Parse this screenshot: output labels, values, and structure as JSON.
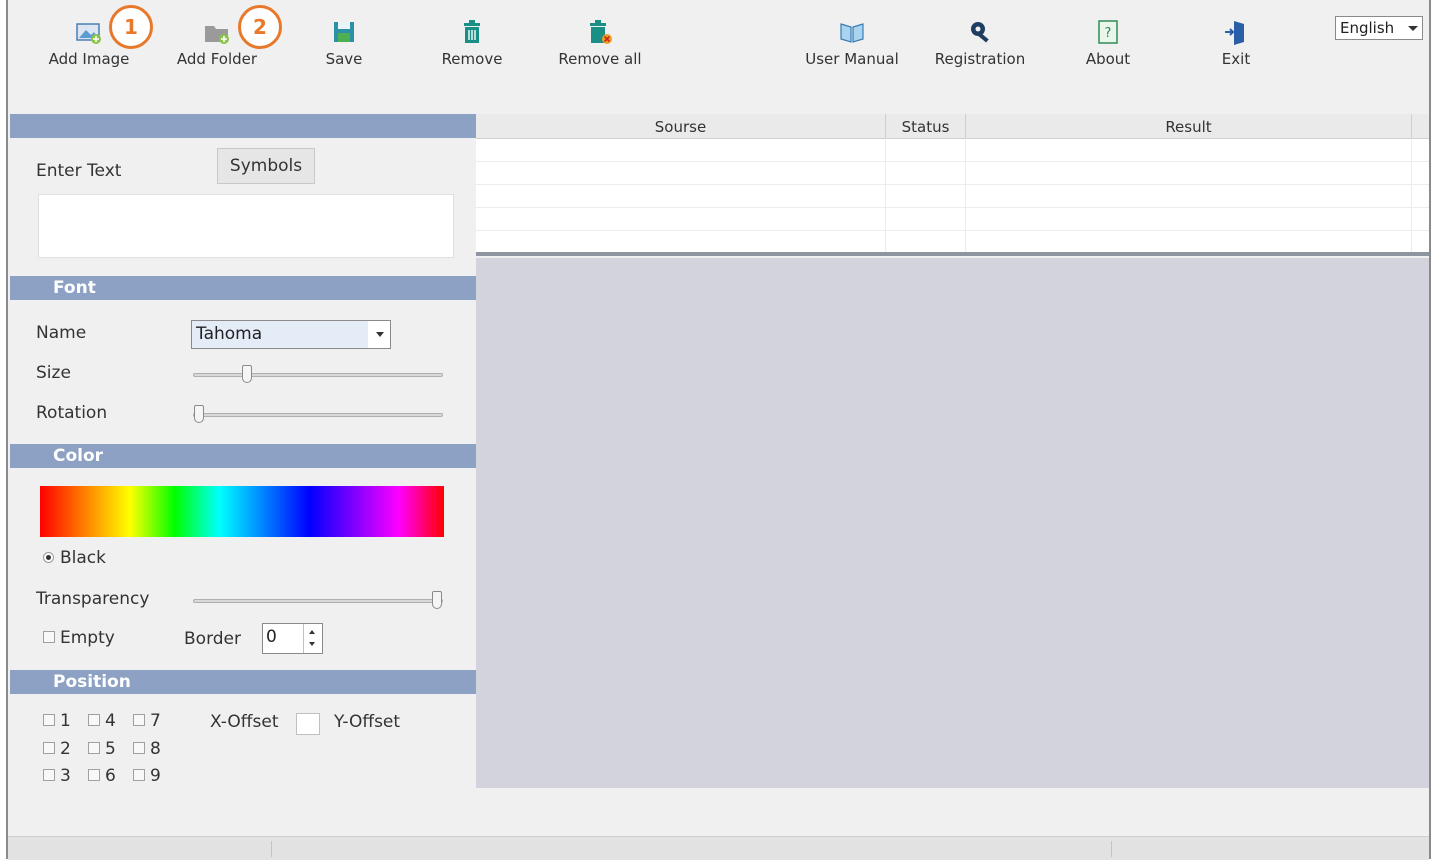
{
  "toolbar": {
    "buttons": [
      {
        "label": "Add Image",
        "icon": "add-image-icon"
      },
      {
        "label": "Add Folder",
        "icon": "add-folder-icon"
      },
      {
        "label": "Save",
        "icon": "save-icon"
      },
      {
        "label": "Remove",
        "icon": "trash-icon"
      },
      {
        "label": "Remove all",
        "icon": "trash-all-icon"
      },
      {
        "label": "User Manual",
        "icon": "book-icon"
      },
      {
        "label": "Registration",
        "icon": "key-icon"
      },
      {
        "label": "About",
        "icon": "help-icon"
      },
      {
        "label": "Exit",
        "icon": "exit-door-icon"
      }
    ],
    "markers": [
      "1",
      "2"
    ],
    "language": "English"
  },
  "text_section": {
    "enter_text_label": "Enter Text",
    "symbols_button": "Symbols",
    "text_value": ""
  },
  "font_section": {
    "header": "Font",
    "name_label": "Name",
    "name_value": "Tahoma",
    "size_label": "Size",
    "size_level": 0.2,
    "rotation_label": "Rotation",
    "rotation_level": 0.0
  },
  "color_section": {
    "header": "Color",
    "selected_color": "Black",
    "transparency_label": "Transparency",
    "transparency_level": 1.0,
    "empty_label": "Empty",
    "border_label": "Border",
    "border_value": "0"
  },
  "position_section": {
    "header": "Position",
    "checkboxes": [
      "1",
      "4",
      "7",
      "2",
      "5",
      "8",
      "3",
      "6",
      "9"
    ],
    "x_offset_label": "X-Offset",
    "y_offset_label": "Y-Offset"
  },
  "grid": {
    "columns": [
      "Sourse",
      "Status",
      "Result"
    ]
  },
  "colors": {
    "section_header": "#8ca1c3",
    "preview_bg": "#d3d3dd",
    "marker": "#e8782a"
  }
}
